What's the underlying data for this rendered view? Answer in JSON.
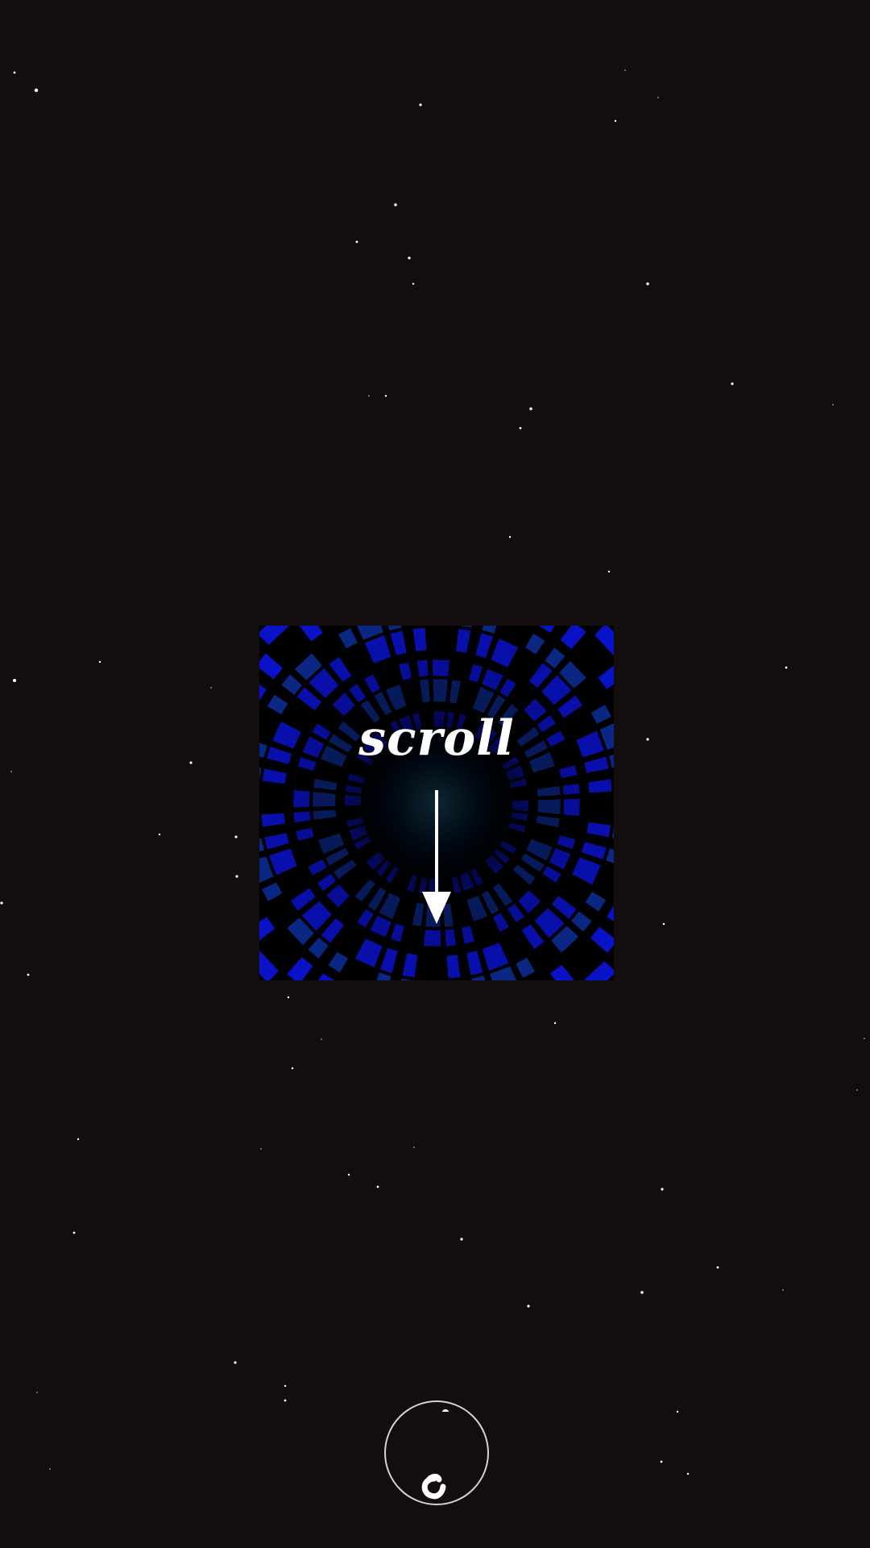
{
  "page": {
    "background_color": "#140d0e"
  },
  "starfield": {
    "star_color": "#ffffff",
    "dim_star_color": "#8a8384"
  },
  "hero": {
    "tunnel_primary_color": "#0a12c8",
    "tunnel_secondary_color": "#0b2a8a",
    "tunnel_core_color": "#0b2730",
    "scroll_label": "scroll",
    "scroll_arrow_icon": "arrow-down-icon"
  },
  "controls": {
    "toggle_button_icon": "rotating-circle-icon",
    "border_color": "#d8d2d2"
  }
}
